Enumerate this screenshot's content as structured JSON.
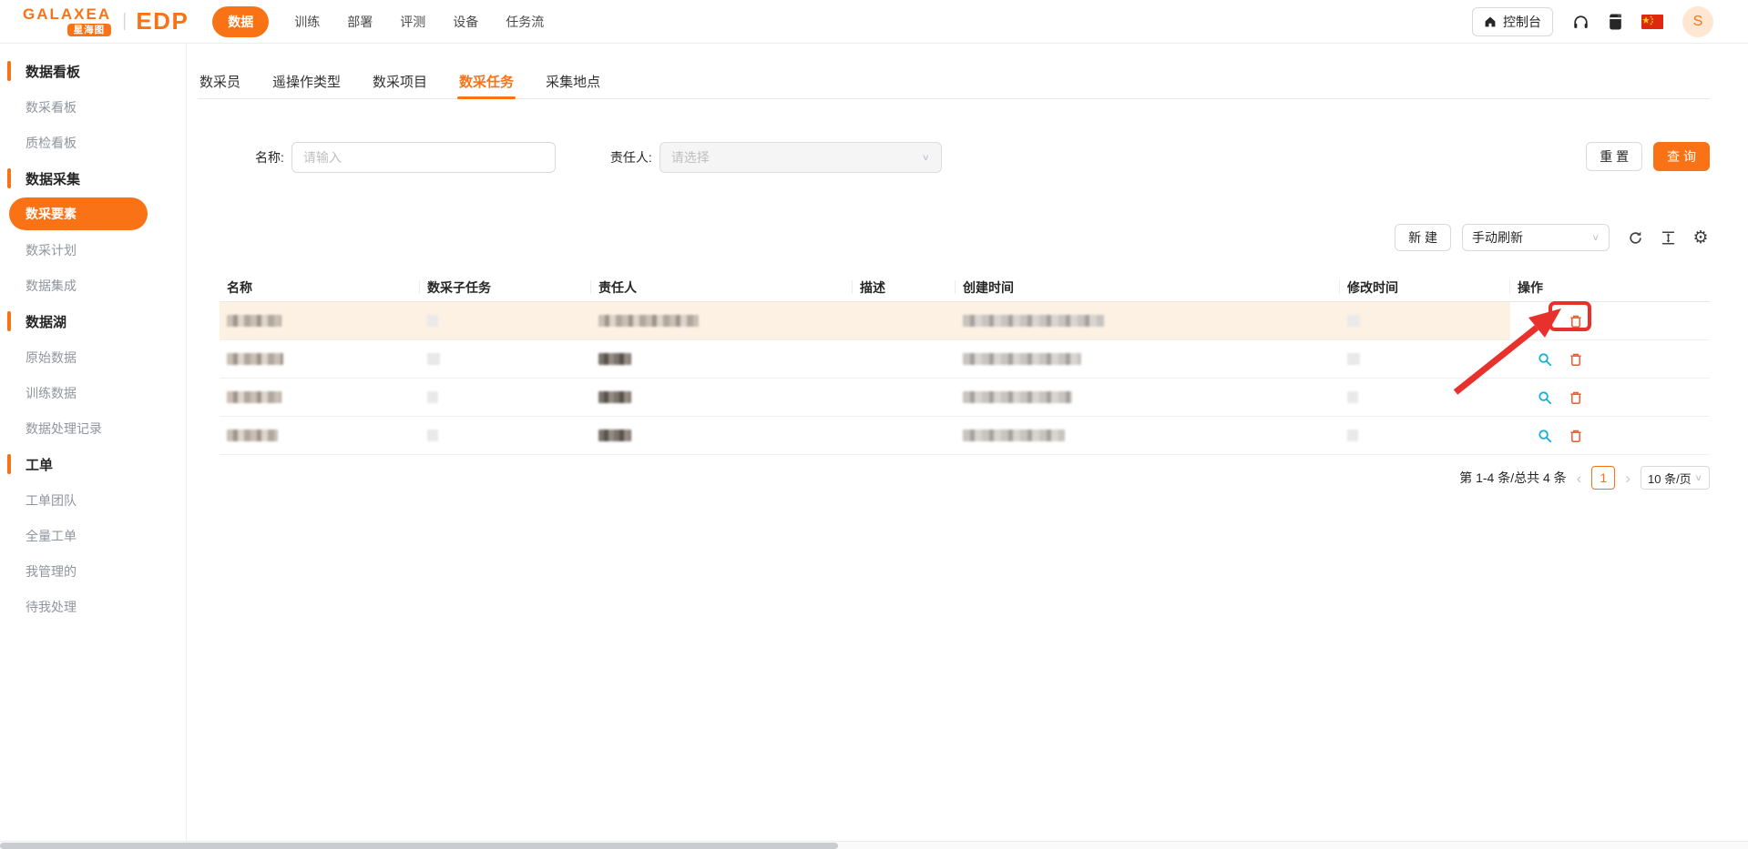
{
  "colors": {
    "primary": "#f97316",
    "annotation_red": "#e8312c",
    "view_icon": "#14aed6",
    "delete_icon": "#fa552d",
    "row_highlight": "#fdf1e3",
    "avatar_bg": "#fde7d2"
  },
  "header": {
    "brand": "GALAXEA",
    "brand_sub": "星海图",
    "divider": "|",
    "product": "EDP",
    "nav": [
      {
        "label": "数据",
        "active": true
      },
      {
        "label": "训练",
        "active": false
      },
      {
        "label": "部署",
        "active": false
      },
      {
        "label": "评测",
        "active": false
      },
      {
        "label": "设备",
        "active": false
      },
      {
        "label": "任务流",
        "active": false
      }
    ],
    "console_button": "控制台",
    "avatar": "S"
  },
  "sidebar": {
    "groups": [
      {
        "title": "数据看板",
        "items": [
          {
            "label": "数采看板",
            "active": false
          },
          {
            "label": "质检看板",
            "active": false
          }
        ]
      },
      {
        "title": "数据采集",
        "items": [
          {
            "label": "数采要素",
            "active": true
          },
          {
            "label": "数采计划",
            "active": false
          },
          {
            "label": "数据集成",
            "active": false
          }
        ]
      },
      {
        "title": "数据湖",
        "items": [
          {
            "label": "原始数据",
            "active": false
          },
          {
            "label": "训练数据",
            "active": false
          },
          {
            "label": "数据处理记录",
            "active": false
          }
        ]
      },
      {
        "title": "工单",
        "items": [
          {
            "label": "工单团队",
            "active": false
          },
          {
            "label": "全量工单",
            "active": false
          },
          {
            "label": "我管理的",
            "active": false
          },
          {
            "label": "待我处理",
            "active": false
          }
        ]
      }
    ]
  },
  "tabs": [
    {
      "label": "数采员",
      "active": false
    },
    {
      "label": "遥操作类型",
      "active": false
    },
    {
      "label": "数采项目",
      "active": false
    },
    {
      "label": "数采任务",
      "active": true
    },
    {
      "label": "采集地点",
      "active": false
    }
  ],
  "filters": {
    "name_label": "名称:",
    "name_placeholder": "请输入",
    "owner_label": "责任人:",
    "owner_placeholder": "请选择",
    "reset_button": "重 置",
    "search_button": "查 询"
  },
  "toolbar": {
    "new_button": "新 建",
    "refresh_mode": "手动刷新"
  },
  "table": {
    "columns": [
      "名称",
      "数采子任务",
      "责任人",
      "描述",
      "创建时间",
      "修改时间",
      "操作"
    ],
    "rows": [
      {
        "highlighted": true,
        "annotated_delete": true,
        "owner_tone": "warm",
        "redactions": {
          "name": 60,
          "subtask": 12,
          "owner": 110,
          "desc": 0,
          "created": 155,
          "modified": 14
        }
      },
      {
        "highlighted": false,
        "annotated_delete": false,
        "owner_tone": "dark",
        "redactions": {
          "name": 62,
          "subtask": 14,
          "owner": 36,
          "desc": 0,
          "created": 130,
          "modified": 14
        }
      },
      {
        "highlighted": false,
        "annotated_delete": false,
        "owner_tone": "dark",
        "redactions": {
          "name": 60,
          "subtask": 12,
          "owner": 36,
          "desc": 0,
          "created": 120,
          "modified": 12
        }
      },
      {
        "highlighted": false,
        "annotated_delete": false,
        "owner_tone": "dark",
        "redactions": {
          "name": 56,
          "subtask": 12,
          "owner": 36,
          "desc": 0,
          "created": 112,
          "modified": 12
        }
      }
    ]
  },
  "pagination": {
    "total": "第 1-4 条/总共 4 条",
    "prev": "‹",
    "page": "1",
    "next": "›",
    "page_size": "10 条/页"
  }
}
